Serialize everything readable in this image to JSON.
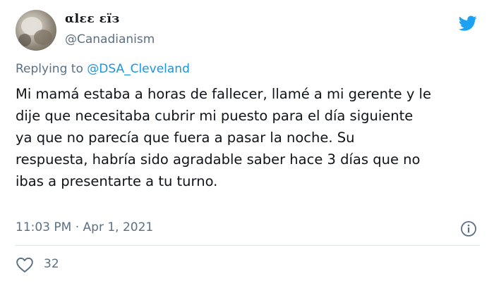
{
  "user": {
    "display_name": "αlεε εïз",
    "handle": "@Canadianism"
  },
  "reply": {
    "prefix": "Replying to ",
    "mention": "@DSA_Cleveland"
  },
  "tweet": {
    "text": "Mi mamá estaba a horas de fallecer, llamé a mi gerente y le\ndije que necesitaba cubrir mi puesto para el día siguiente\nya que no parecía que fuera a pasar la noche. Su\nrespuesta, habría sido agradable saber hace 3 días que no\nibas a presentarte a tu turno.",
    "timestamp": "11:03 PM · Apr 1, 2021"
  },
  "engagement": {
    "likes": "32"
  },
  "icons": {
    "brand": "twitter-bird-icon",
    "info": "info-icon",
    "like": "heart-icon"
  },
  "colors": {
    "brand": "#1da1f2",
    "link": "#1b95e0",
    "muted": "#5b7083",
    "text": "#0f1419"
  }
}
